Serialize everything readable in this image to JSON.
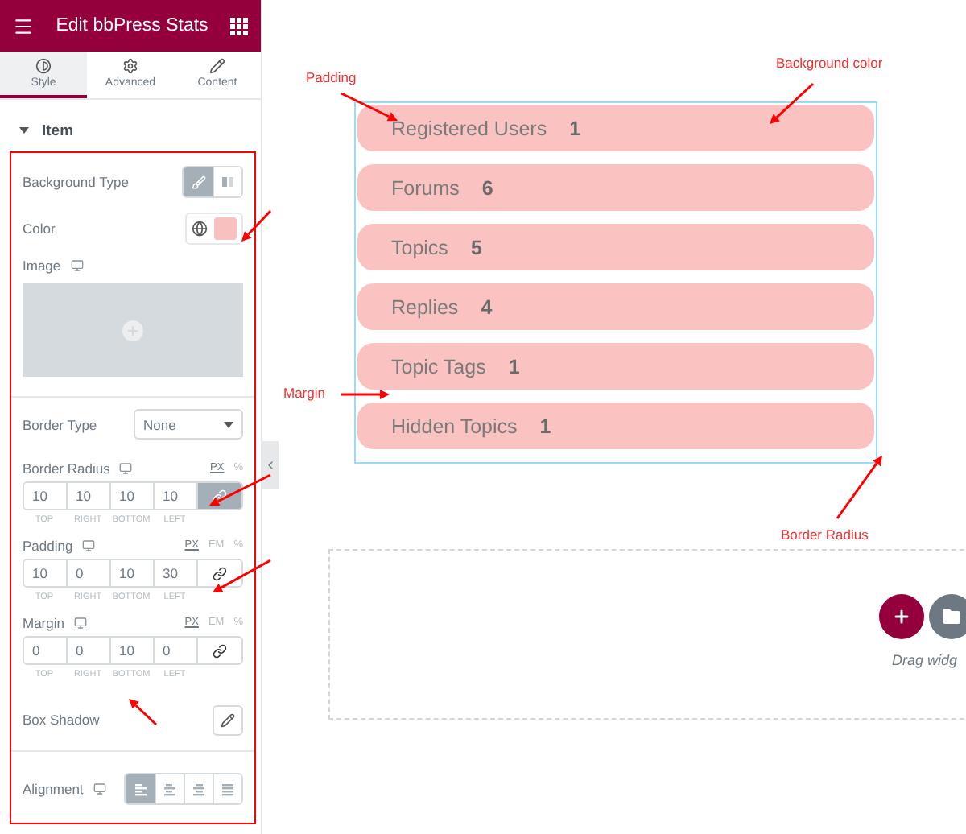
{
  "header": {
    "title": "Edit bbPress Stats"
  },
  "tabs": [
    {
      "label": "Style",
      "selected": true
    },
    {
      "label": "Advanced",
      "selected": false
    },
    {
      "label": "Content",
      "selected": false
    }
  ],
  "section": {
    "title": "Item",
    "expanded": true
  },
  "controls": [
    {
      "kind": "bg-type",
      "label": "Background Type",
      "options": [
        {
          "selected": true
        },
        {
          "selected": false
        }
      ]
    },
    {
      "kind": "color",
      "label": "Color",
      "color": "#f9c0c0"
    },
    {
      "kind": "media",
      "label": "Image",
      "responsive": true
    },
    {
      "kind": "select",
      "label": "Border Type",
      "value": "None",
      "separated": true
    },
    {
      "kind": "dimensions",
      "label": "Border Radius",
      "responsive": true,
      "units": [
        {
          "label": "PX",
          "selected": true
        },
        {
          "label": "%",
          "selected": false
        }
      ],
      "values": [
        "10",
        "10",
        "10",
        "10"
      ],
      "sublabels": [
        "TOP",
        "RIGHT",
        "BOTTOM",
        "LEFT"
      ],
      "linked": true
    },
    {
      "kind": "dimensions",
      "label": "Padding",
      "responsive": true,
      "units": [
        {
          "label": "PX",
          "selected": true
        },
        {
          "label": "EM",
          "selected": false
        },
        {
          "label": "%",
          "selected": false
        }
      ],
      "values": [
        "10",
        "0",
        "10",
        "30"
      ],
      "sublabels": [
        "TOP",
        "RIGHT",
        "BOTTOM",
        "LEFT"
      ],
      "linked": false
    },
    {
      "kind": "dimensions",
      "label": "Margin",
      "responsive": true,
      "units": [
        {
          "label": "PX",
          "selected": true
        },
        {
          "label": "EM",
          "selected": false
        },
        {
          "label": "%",
          "selected": false
        }
      ],
      "values": [
        "0",
        "0",
        "10",
        "0"
      ],
      "sublabels": [
        "TOP",
        "RIGHT",
        "BOTTOM",
        "LEFT"
      ],
      "linked": false
    },
    {
      "kind": "popover",
      "label": "Box Shadow"
    },
    {
      "kind": "align",
      "label": "Alignment",
      "responsive": true,
      "separated": true,
      "options": [
        {
          "selected": true
        },
        {
          "selected": false
        },
        {
          "selected": false
        },
        {
          "selected": false
        }
      ]
    }
  ],
  "stats": [
    {
      "label": "Registered Users",
      "value": "1"
    },
    {
      "label": "Forums",
      "value": "6"
    },
    {
      "label": "Topics",
      "value": "5"
    },
    {
      "label": "Replies",
      "value": "4"
    },
    {
      "label": "Topic Tags",
      "value": "1"
    },
    {
      "label": "Hidden Topics",
      "value": "1"
    }
  ],
  "drop_area": {
    "hint": "Drag widg"
  },
  "annotations": [
    "Padding",
    "Background color",
    "Margin",
    "Border Radius"
  ]
}
